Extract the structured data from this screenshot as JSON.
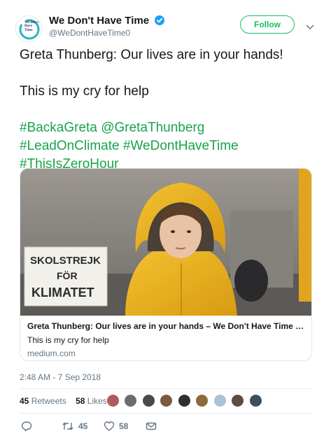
{
  "account": {
    "display_name": "We Don't Have Time",
    "handle": "@WeDontHaveTime0",
    "avatar_text": "We Don't Have Time.",
    "verified": true
  },
  "follow_label": "Follow",
  "tweet": {
    "line1": "Greta Thunberg: Our lives are in your hands!",
    "line2": "This is my cry for help",
    "tags": {
      "backagreta": "#BackaGreta",
      "mention": "@GretaThunberg",
      "leadonclimate": "#LeadOnClimate",
      "wedonthavetime": "#WeDontHaveTime",
      "thisiszerohour": "#ThisIsZeroHour"
    }
  },
  "card": {
    "sign_line1": "SKOLSTREJK",
    "sign_line2": "FÖR",
    "sign_line3": "KLIMATET",
    "title": "Greta Thunberg: Our lives are in your hands – We Don't Have Time – Medi…",
    "description": "This is my cry for help",
    "domain": "medium.com"
  },
  "timestamp": "2:48 AM - 7 Sep 2018",
  "stats": {
    "retweets_count": "45",
    "retweets_label": "Retweets",
    "likes_count": "58",
    "likes_label": "Likes"
  },
  "actions": {
    "retweet_count": "45",
    "like_count": "58"
  },
  "colors": {
    "accent_green": "#17a34a",
    "verified_blue": "#1da1f2",
    "muted": "#657786"
  }
}
